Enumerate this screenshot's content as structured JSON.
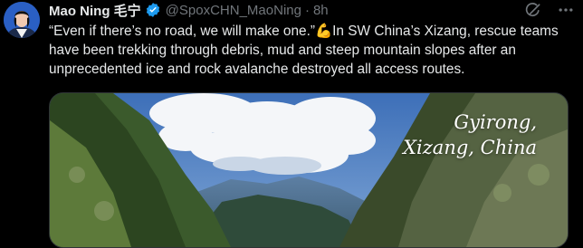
{
  "author": {
    "display_name": "Mao Ning 毛宁",
    "handle": "@SpoxCHN_MaoNing",
    "separator": "·",
    "time": "8h",
    "avatar_icon": "profile-photo",
    "verified_icon": "verified-badge-icon"
  },
  "tweet": {
    "text": "“Even if there’s no road, we will make one.”💪In SW China’s Xizang, rescue teams have been trekking through debris, mud and steep mountain slopes after an unprecedented ice and rock avalanche destroyed all access routes."
  },
  "media": {
    "caption_line1": "Gyirong,",
    "caption_line2": "Xizang, China"
  },
  "icons": {
    "grok": "grok-icon",
    "more": "more-options-icon"
  },
  "colors": {
    "background": "#000000",
    "text": "#e7e9ea",
    "muted": "#71767b",
    "verified": "#1d9bf0"
  }
}
